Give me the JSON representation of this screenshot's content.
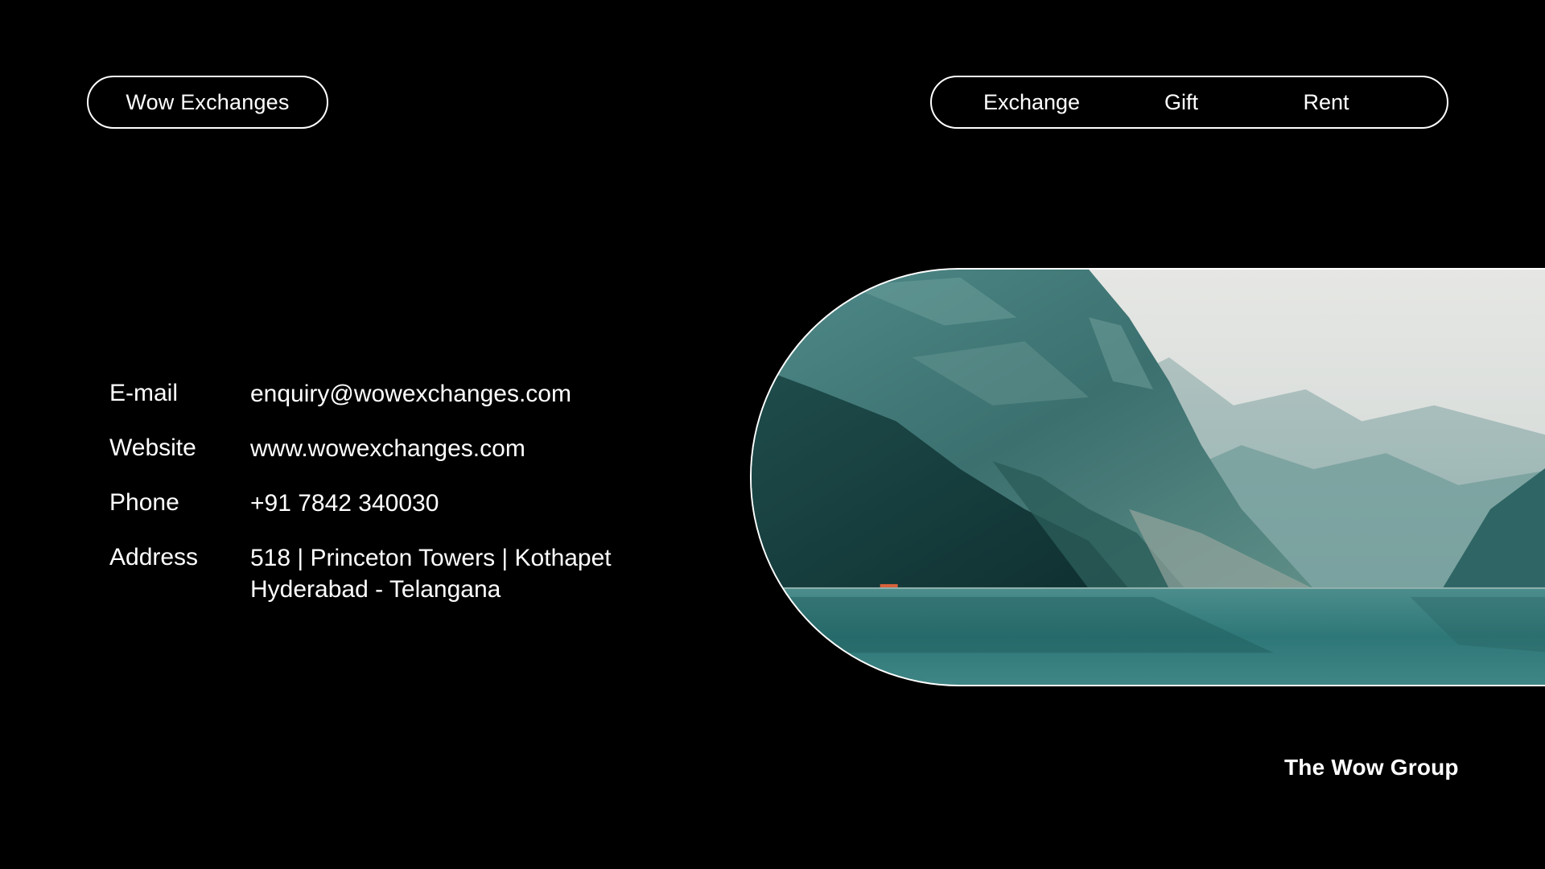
{
  "header": {
    "brand": "Wow Exchanges",
    "nav": {
      "exchange": "Exchange",
      "gift": "Gift",
      "rent": "Rent"
    }
  },
  "contact": {
    "email_label": "E-mail",
    "email_value": "enquiry@wowexchanges.com",
    "website_label": "Website",
    "website_value": "www.wowexchanges.com",
    "phone_label": "Phone",
    "phone_value": "+91 7842 340030",
    "address_label": "Address",
    "address_line1": "518 | Princeton Towers | Kothapet",
    "address_line2": "Hyderabad - Telangana"
  },
  "footer": {
    "group_name": "The Wow Group"
  },
  "colors": {
    "background": "#000000",
    "text": "#ffffff",
    "water": "#2f7d7e",
    "sky": "#d9dcda"
  }
}
